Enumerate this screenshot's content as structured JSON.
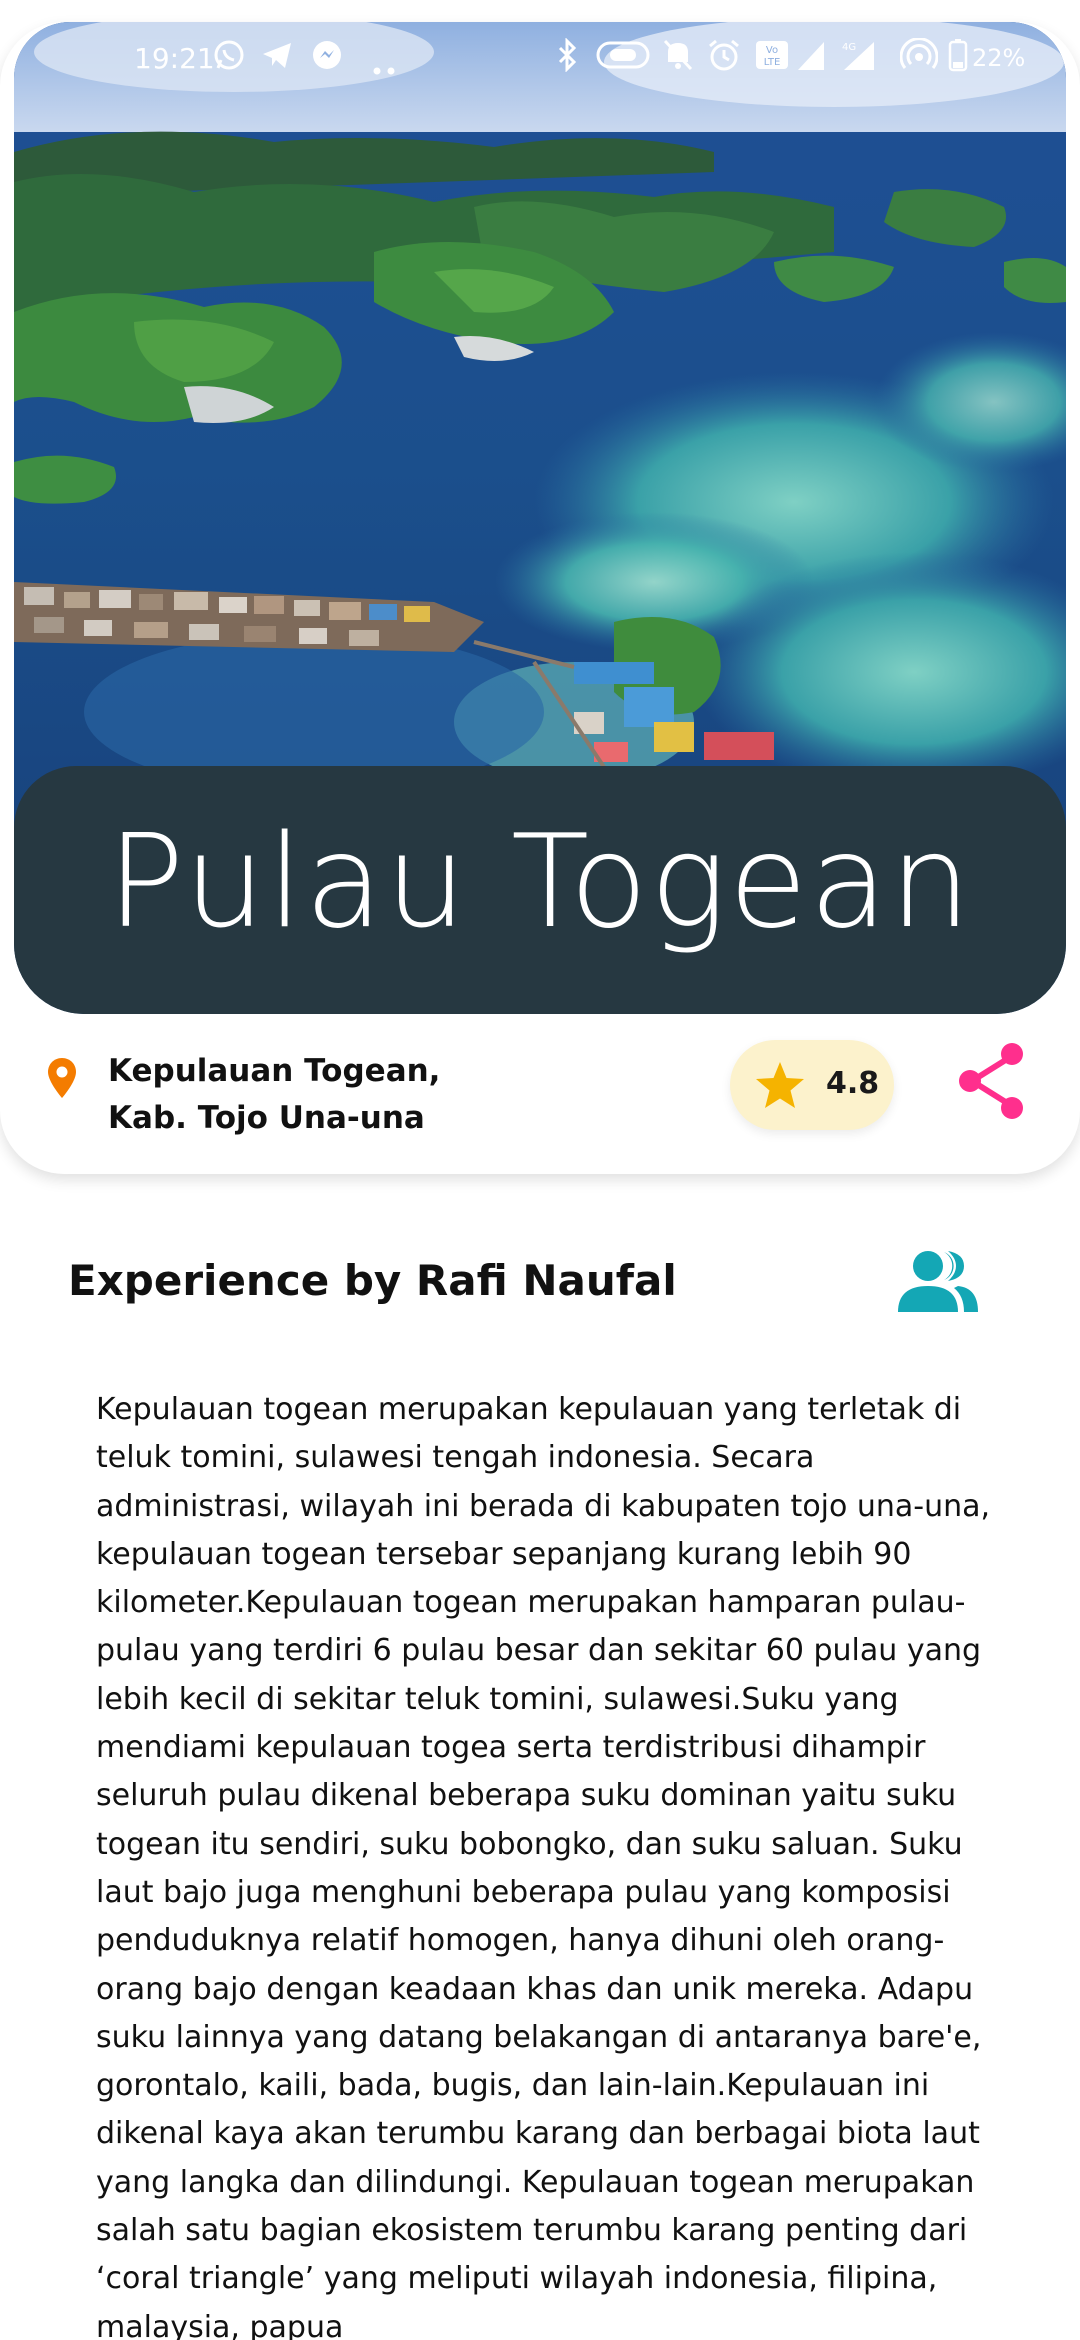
{
  "status_bar": {
    "time": "19:21",
    "battery": "22%",
    "left_icons": [
      "whatsapp-icon",
      "telegram-icon",
      "messenger-icon",
      "more-dots-icon"
    ],
    "right_icons": [
      "bluetooth-icon",
      "nfc-icon",
      "mute-icon",
      "alarm-icon",
      "volte-icon",
      "signal-icon",
      "signal-4g-icon",
      "hotspot-icon",
      "battery-icon"
    ]
  },
  "place": {
    "title": "Pulau Togean",
    "location_line1": "Kepulauan Togean,",
    "location_line2": "Kab. Tojo Una-una",
    "rating": "4.8"
  },
  "experience": {
    "title": "Experience by Rafi Naufal",
    "description": "Kepulauan togean merupakan kepulauan yang terletak di teluk tomini, sulawesi tengah indonesia. Secara administrasi, wilayah ini berada di kabupaten tojo una-una, kepulauan togean tersebar sepanjang kurang lebih 90 kilometer.Kepulauan togean merupakan hamparan pulau-pulau yang terdiri 6 pulau besar dan sekitar 60 pulau yang lebih kecil di sekitar teluk tomini, sulawesi.Suku yang mendiami kepulauan togea serta terdistribusi dihampir seluruh pulau dikenal beberapa suku dominan yaitu suku togean itu sendiri, suku bobongko, dan suku saluan. Suku laut bajo juga menghuni beberapa pulau yang komposisi penduduknya relatif homogen, hanya dihuni oleh orang-orang bajo dengan keadaan khas dan unik mereka. Adapu suku lainnya yang datang belakangan di antaranya bare'e, gorontalo, kaili, bada, bugis, dan lain-lain.Kepulauan ini dikenal kaya akan terumbu karang dan berbagai biota laut yang langka dan dilindungi. Kepulauan togean merupakan salah satu bagian ekosistem terumbu karang penting dari ‘coral triangle’ yang meliputi wilayah indonesia, filipina, malaysia, papua"
  },
  "colors": {
    "title_band": "#263841",
    "pin": "#f47c00",
    "star": "#f5b300",
    "rating_bg": "#fcf2cc",
    "share": "#ff2f8d",
    "people": "#14a7b5"
  }
}
